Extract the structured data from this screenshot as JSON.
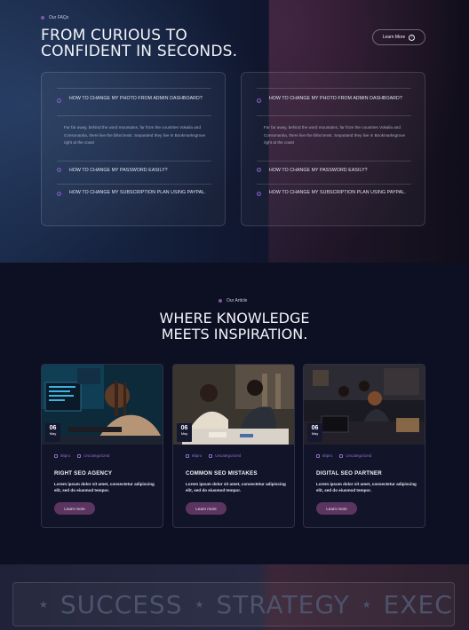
{
  "faq": {
    "eyebrow": "Our FAQs",
    "title": "FROM CURIOUS TO CONFIDENT IN SECONDS.",
    "learn_more": "Learn More",
    "columns": [
      {
        "items": [
          {
            "icon": "minus-circle-icon",
            "question": "HOW TO CHANGE MY PHOTO FROM ADMIN DASHBOARD?",
            "answer": "Far far away, behind the word mountains, far from the countries Vokalia and Consonantia, there live the blind texts. Separated they live in Bookmarksgrove right at the coast"
          },
          {
            "icon": "plus-circle-icon",
            "question": "HOW TO CHANGE MY PASSWORD EASILY?"
          },
          {
            "icon": "plus-circle-icon",
            "question": "HOW TO CHANGE MY SUBSCRIPTION PLAN USING PAYPAL."
          }
        ]
      },
      {
        "items": [
          {
            "icon": "minus-circle-icon",
            "question": "HOW TO CHANGE MY PHOTO FROM ADMIN DASHBOARD?",
            "answer": "Far far away, behind the word mountains, far from the countries Vokalia and Consonantia, there live the blind texts. Separated they live in Bookmarksgrove right at the coast"
          },
          {
            "icon": "plus-circle-icon",
            "question": "HOW TO CHANGE MY PASSWORD EASILY?"
          },
          {
            "icon": "plus-circle-icon",
            "question": "HOW TO CHANGE MY SUBSCRIPTION PLAN USING PAYPAL."
          }
        ]
      }
    ]
  },
  "articles": {
    "eyebrow": "Our Article",
    "title_line1": "WHERE KNOWLEDGE",
    "title_line2": "MEETS INSPIRATION.",
    "posts": [
      {
        "day": "06",
        "month": "May",
        "author": "8itpro",
        "category": "Uncategorized",
        "title": "RIGHT SEO AGENCY",
        "excerpt": "Lorem ipsum dolor sit amet, consectetur adipiscing elit, sed do eiusmod tempor.",
        "button": "Learn more"
      },
      {
        "day": "06",
        "month": "May",
        "author": "8itpro",
        "category": "Uncategorized",
        "title": "COMMON SEO MISTAKES",
        "excerpt": "Lorem ipsum dolor sit amet, consectetur adipiscing elit, sed do eiusmod tempor.",
        "button": "Learn more"
      },
      {
        "day": "06",
        "month": "May",
        "author": "8itpro",
        "category": "Uncategorized",
        "title": "DIGITAL SEO PARTNER",
        "excerpt": "Lorem ipsum dolor sit amet, consectetur adipiscing elit, sed do eiusmod tempor.",
        "button": "Learn more"
      }
    ]
  },
  "marquee": {
    "words": [
      "SUCCESS",
      "STRATEGY",
      "EXEC"
    ]
  },
  "colors": {
    "accent_purple": "#8b5cc7",
    "button_plum": "#5b3560",
    "page_bg": "#0d0f22"
  }
}
